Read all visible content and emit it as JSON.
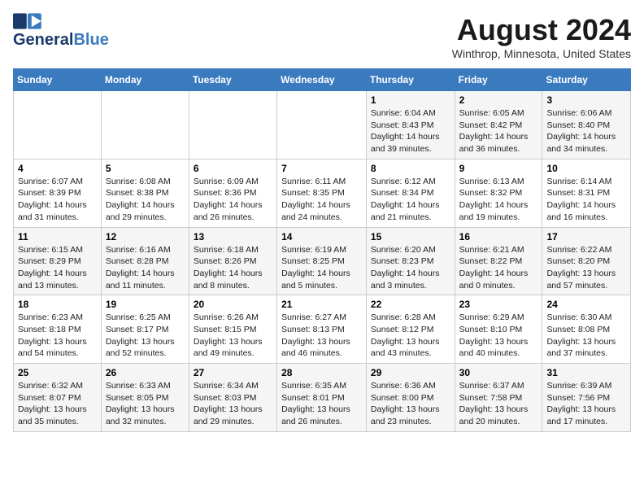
{
  "header": {
    "logo_line1": "General",
    "logo_line2": "Blue",
    "month_year": "August 2024",
    "location": "Winthrop, Minnesota, United States"
  },
  "weekdays": [
    "Sunday",
    "Monday",
    "Tuesday",
    "Wednesday",
    "Thursday",
    "Friday",
    "Saturday"
  ],
  "weeks": [
    [
      {
        "day": "",
        "info": ""
      },
      {
        "day": "",
        "info": ""
      },
      {
        "day": "",
        "info": ""
      },
      {
        "day": "",
        "info": ""
      },
      {
        "day": "1",
        "info": "Sunrise: 6:04 AM\nSunset: 8:43 PM\nDaylight: 14 hours and 39 minutes."
      },
      {
        "day": "2",
        "info": "Sunrise: 6:05 AM\nSunset: 8:42 PM\nDaylight: 14 hours and 36 minutes."
      },
      {
        "day": "3",
        "info": "Sunrise: 6:06 AM\nSunset: 8:40 PM\nDaylight: 14 hours and 34 minutes."
      }
    ],
    [
      {
        "day": "4",
        "info": "Sunrise: 6:07 AM\nSunset: 8:39 PM\nDaylight: 14 hours and 31 minutes."
      },
      {
        "day": "5",
        "info": "Sunrise: 6:08 AM\nSunset: 8:38 PM\nDaylight: 14 hours and 29 minutes."
      },
      {
        "day": "6",
        "info": "Sunrise: 6:09 AM\nSunset: 8:36 PM\nDaylight: 14 hours and 26 minutes."
      },
      {
        "day": "7",
        "info": "Sunrise: 6:11 AM\nSunset: 8:35 PM\nDaylight: 14 hours and 24 minutes."
      },
      {
        "day": "8",
        "info": "Sunrise: 6:12 AM\nSunset: 8:34 PM\nDaylight: 14 hours and 21 minutes."
      },
      {
        "day": "9",
        "info": "Sunrise: 6:13 AM\nSunset: 8:32 PM\nDaylight: 14 hours and 19 minutes."
      },
      {
        "day": "10",
        "info": "Sunrise: 6:14 AM\nSunset: 8:31 PM\nDaylight: 14 hours and 16 minutes."
      }
    ],
    [
      {
        "day": "11",
        "info": "Sunrise: 6:15 AM\nSunset: 8:29 PM\nDaylight: 14 hours and 13 minutes."
      },
      {
        "day": "12",
        "info": "Sunrise: 6:16 AM\nSunset: 8:28 PM\nDaylight: 14 hours and 11 minutes."
      },
      {
        "day": "13",
        "info": "Sunrise: 6:18 AM\nSunset: 8:26 PM\nDaylight: 14 hours and 8 minutes."
      },
      {
        "day": "14",
        "info": "Sunrise: 6:19 AM\nSunset: 8:25 PM\nDaylight: 14 hours and 5 minutes."
      },
      {
        "day": "15",
        "info": "Sunrise: 6:20 AM\nSunset: 8:23 PM\nDaylight: 14 hours and 3 minutes."
      },
      {
        "day": "16",
        "info": "Sunrise: 6:21 AM\nSunset: 8:22 PM\nDaylight: 14 hours and 0 minutes."
      },
      {
        "day": "17",
        "info": "Sunrise: 6:22 AM\nSunset: 8:20 PM\nDaylight: 13 hours and 57 minutes."
      }
    ],
    [
      {
        "day": "18",
        "info": "Sunrise: 6:23 AM\nSunset: 8:18 PM\nDaylight: 13 hours and 54 minutes."
      },
      {
        "day": "19",
        "info": "Sunrise: 6:25 AM\nSunset: 8:17 PM\nDaylight: 13 hours and 52 minutes."
      },
      {
        "day": "20",
        "info": "Sunrise: 6:26 AM\nSunset: 8:15 PM\nDaylight: 13 hours and 49 minutes."
      },
      {
        "day": "21",
        "info": "Sunrise: 6:27 AM\nSunset: 8:13 PM\nDaylight: 13 hours and 46 minutes."
      },
      {
        "day": "22",
        "info": "Sunrise: 6:28 AM\nSunset: 8:12 PM\nDaylight: 13 hours and 43 minutes."
      },
      {
        "day": "23",
        "info": "Sunrise: 6:29 AM\nSunset: 8:10 PM\nDaylight: 13 hours and 40 minutes."
      },
      {
        "day": "24",
        "info": "Sunrise: 6:30 AM\nSunset: 8:08 PM\nDaylight: 13 hours and 37 minutes."
      }
    ],
    [
      {
        "day": "25",
        "info": "Sunrise: 6:32 AM\nSunset: 8:07 PM\nDaylight: 13 hours and 35 minutes."
      },
      {
        "day": "26",
        "info": "Sunrise: 6:33 AM\nSunset: 8:05 PM\nDaylight: 13 hours and 32 minutes."
      },
      {
        "day": "27",
        "info": "Sunrise: 6:34 AM\nSunset: 8:03 PM\nDaylight: 13 hours and 29 minutes."
      },
      {
        "day": "28",
        "info": "Sunrise: 6:35 AM\nSunset: 8:01 PM\nDaylight: 13 hours and 26 minutes."
      },
      {
        "day": "29",
        "info": "Sunrise: 6:36 AM\nSunset: 8:00 PM\nDaylight: 13 hours and 23 minutes."
      },
      {
        "day": "30",
        "info": "Sunrise: 6:37 AM\nSunset: 7:58 PM\nDaylight: 13 hours and 20 minutes."
      },
      {
        "day": "31",
        "info": "Sunrise: 6:39 AM\nSunset: 7:56 PM\nDaylight: 13 hours and 17 minutes."
      }
    ]
  ]
}
